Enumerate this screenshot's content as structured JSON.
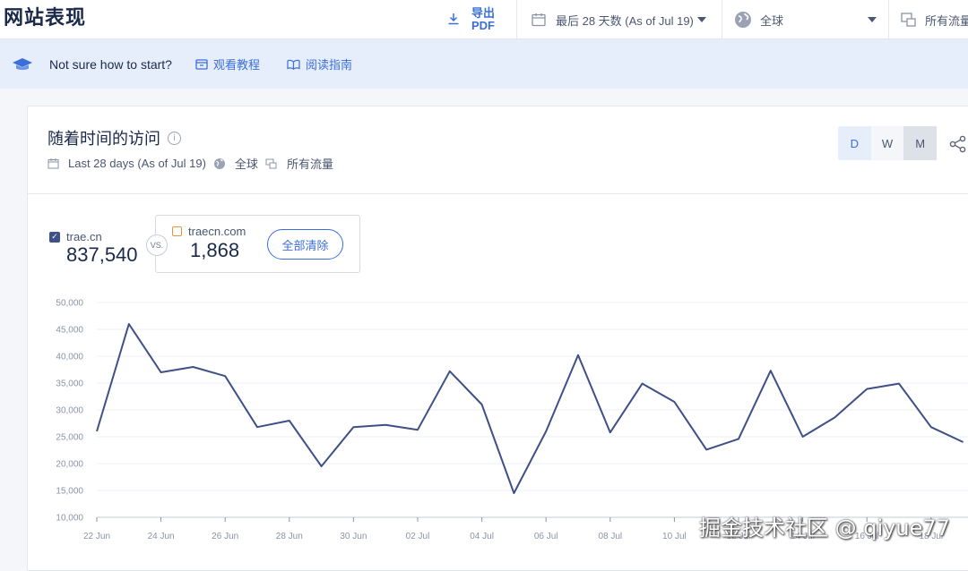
{
  "header": {
    "title": "网站表现",
    "export_line1": "导出",
    "export_line2": "PDF",
    "date_range": "最后 28 天数 (As of Jul 19)",
    "region": "全球",
    "traffic": "所有流量"
  },
  "banner": {
    "question": "Not sure how to start?",
    "watch_tutorial": "观看教程",
    "read_guide": "阅读指南"
  },
  "card": {
    "title": "随着时间的访问",
    "meta_range": "Last 28 days (As of Jul 19)",
    "meta_region": "全球",
    "meta_traffic": "所有流量",
    "granularity": [
      "D",
      "W",
      "M"
    ]
  },
  "sites": {
    "primary": {
      "name": "trae.cn",
      "value": "837,540"
    },
    "vs_label": "VS.",
    "compare": {
      "name": "traecn.com",
      "value": "1,868"
    },
    "clear_all": "全部清除"
  },
  "chart_data": {
    "type": "line",
    "ylim": [
      10000,
      50000
    ],
    "yticks": [
      "10,000",
      "15,000",
      "20,000",
      "25,000",
      "30,000",
      "35,000",
      "40,000",
      "45,000",
      "50,000"
    ],
    "x": [
      "22 Jun",
      "23 Jun",
      "24 Jun",
      "25 Jun",
      "26 Jun",
      "27 Jun",
      "28 Jun",
      "29 Jun",
      "30 Jun",
      "01 Jul",
      "02 Jul",
      "03 Jul",
      "04 Jul",
      "05 Jul",
      "06 Jul",
      "07 Jul",
      "08 Jul",
      "09 Jul",
      "10 Jul",
      "11 Jul",
      "12 Jul",
      "13 Jul",
      "14 Jul",
      "15 Jul",
      "16 Jul",
      "17 Jul",
      "18 Jul",
      "19 Jul"
    ],
    "xtick_labels": [
      "22 Jun",
      "24 Jun",
      "26 Jun",
      "28 Jun",
      "30 Jun",
      "02 Jul",
      "04 Jul",
      "06 Jul",
      "08 Jul",
      "10 Jul",
      "12 Jul",
      "14 Jul",
      "16 Jul",
      "18 Jul"
    ],
    "series": [
      {
        "name": "trae.cn",
        "color": "#3f4f87",
        "values": [
          26000,
          46000,
          37000,
          38000,
          36300,
          26800,
          28000,
          19500,
          26800,
          27200,
          26300,
          37200,
          31000,
          14500,
          26000,
          40200,
          25800,
          34900,
          31500,
          22600,
          24600,
          37300,
          25000,
          28600,
          33900,
          34900,
          26800,
          24000
        ]
      }
    ],
    "grid": true
  },
  "watermark": "掘金技术社区 @ qiyue77"
}
